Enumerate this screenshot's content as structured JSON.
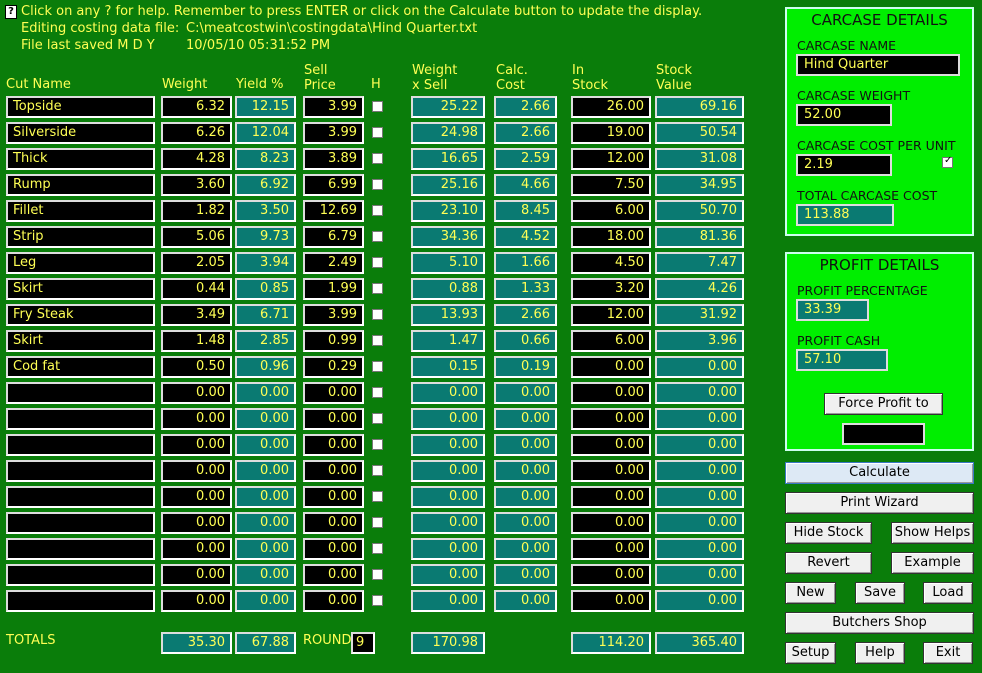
{
  "header": {
    "help_icon": "?",
    "line1": "Click on any ? for help. Remember to press ENTER or click on the Calculate button to update the display.",
    "line2_label": "Editing costing data file:",
    "line2_value": "C:\\meatcostwin\\costingdata\\Hind Quarter.txt",
    "line3_label": "File last saved M D Y",
    "line3_value": "10/05/10 05:31:52 PM"
  },
  "columns": {
    "cut_name": "Cut Name",
    "weight": "Weight",
    "yield": "Yield %",
    "sell_price": "Sell\nPrice",
    "h": "H",
    "weight_x_sell": "Weight\nx Sell",
    "calc_cost": "Calc.\nCost",
    "in_stock": "In\nStock",
    "stock_value": "Stock\nValue"
  },
  "rows": [
    {
      "name": "Topside",
      "weight": "6.32",
      "yield": "12.15",
      "price": "3.99",
      "wxs": "25.22",
      "cost": "2.66",
      "stock": "26.00",
      "value": "69.16"
    },
    {
      "name": "Silverside",
      "weight": "6.26",
      "yield": "12.04",
      "price": "3.99",
      "wxs": "24.98",
      "cost": "2.66",
      "stock": "19.00",
      "value": "50.54"
    },
    {
      "name": "Thick",
      "weight": "4.28",
      "yield": "8.23",
      "price": "3.89",
      "wxs": "16.65",
      "cost": "2.59",
      "stock": "12.00",
      "value": "31.08"
    },
    {
      "name": "Rump",
      "weight": "3.60",
      "yield": "6.92",
      "price": "6.99",
      "wxs": "25.16",
      "cost": "4.66",
      "stock": "7.50",
      "value": "34.95"
    },
    {
      "name": "Fillet",
      "weight": "1.82",
      "yield": "3.50",
      "price": "12.69",
      "wxs": "23.10",
      "cost": "8.45",
      "stock": "6.00",
      "value": "50.70"
    },
    {
      "name": "Strip",
      "weight": "5.06",
      "yield": "9.73",
      "price": "6.79",
      "wxs": "34.36",
      "cost": "4.52",
      "stock": "18.00",
      "value": "81.36"
    },
    {
      "name": "Leg",
      "weight": "2.05",
      "yield": "3.94",
      "price": "2.49",
      "wxs": "5.10",
      "cost": "1.66",
      "stock": "4.50",
      "value": "7.47"
    },
    {
      "name": "Skirt",
      "weight": "0.44",
      "yield": "0.85",
      "price": "1.99",
      "wxs": "0.88",
      "cost": "1.33",
      "stock": "3.20",
      "value": "4.26"
    },
    {
      "name": "Fry Steak",
      "weight": "3.49",
      "yield": "6.71",
      "price": "3.99",
      "wxs": "13.93",
      "cost": "2.66",
      "stock": "12.00",
      "value": "31.92"
    },
    {
      "name": "Skirt",
      "weight": "1.48",
      "yield": "2.85",
      "price": "0.99",
      "wxs": "1.47",
      "cost": "0.66",
      "stock": "6.00",
      "value": "3.96"
    },
    {
      "name": "Cod fat",
      "weight": "0.50",
      "yield": "0.96",
      "price": "0.29",
      "wxs": "0.15",
      "cost": "0.19",
      "stock": "0.00",
      "value": "0.00"
    },
    {
      "name": "",
      "weight": "0.00",
      "yield": "0.00",
      "price": "0.00",
      "wxs": "0.00",
      "cost": "0.00",
      "stock": "0.00",
      "value": "0.00"
    },
    {
      "name": "",
      "weight": "0.00",
      "yield": "0.00",
      "price": "0.00",
      "wxs": "0.00",
      "cost": "0.00",
      "stock": "0.00",
      "value": "0.00"
    },
    {
      "name": "",
      "weight": "0.00",
      "yield": "0.00",
      "price": "0.00",
      "wxs": "0.00",
      "cost": "0.00",
      "stock": "0.00",
      "value": "0.00"
    },
    {
      "name": "",
      "weight": "0.00",
      "yield": "0.00",
      "price": "0.00",
      "wxs": "0.00",
      "cost": "0.00",
      "stock": "0.00",
      "value": "0.00"
    },
    {
      "name": "",
      "weight": "0.00",
      "yield": "0.00",
      "price": "0.00",
      "wxs": "0.00",
      "cost": "0.00",
      "stock": "0.00",
      "value": "0.00"
    },
    {
      "name": "",
      "weight": "0.00",
      "yield": "0.00",
      "price": "0.00",
      "wxs": "0.00",
      "cost": "0.00",
      "stock": "0.00",
      "value": "0.00"
    },
    {
      "name": "",
      "weight": "0.00",
      "yield": "0.00",
      "price": "0.00",
      "wxs": "0.00",
      "cost": "0.00",
      "stock": "0.00",
      "value": "0.00"
    },
    {
      "name": "",
      "weight": "0.00",
      "yield": "0.00",
      "price": "0.00",
      "wxs": "0.00",
      "cost": "0.00",
      "stock": "0.00",
      "value": "0.00"
    },
    {
      "name": "",
      "weight": "0.00",
      "yield": "0.00",
      "price": "0.00",
      "wxs": "0.00",
      "cost": "0.00",
      "stock": "0.00",
      "value": "0.00"
    }
  ],
  "totals": {
    "label": "TOTALS",
    "weight": "35.30",
    "yield": "67.88",
    "round_label": "ROUND",
    "round_value": "9",
    "wxs": "170.98",
    "stock": "114.20",
    "value": "365.40"
  },
  "carcase": {
    "title": "CARCASE DETAILS",
    "name_label": "CARCASE NAME",
    "name_value": "Hind Quarter",
    "weight_label": "CARCASE WEIGHT",
    "weight_value": "52.00",
    "cost_label": "CARCASE COST PER UNIT",
    "cost_value": "2.19",
    "total_label": "TOTAL CARCASE COST",
    "total_value": "113.88"
  },
  "profit": {
    "title": "PROFIT DETAILS",
    "pct_label": "PROFIT PERCENTAGE",
    "pct_value": "33.39",
    "cash_label": "PROFIT CASH",
    "cash_value": "57.10",
    "force_label": "Force Profit to",
    "force_value": ""
  },
  "buttons": {
    "calculate": "Calculate",
    "print_wizard": "Print Wizard",
    "hide_stock": "Hide Stock",
    "show_helps": "Show Helps",
    "revert": "Revert",
    "example": "Example",
    "new": "New",
    "save": "Save",
    "load": "Load",
    "butchers_shop": "Butchers Shop",
    "setup": "Setup",
    "help": "Help",
    "exit": "Exit"
  },
  "colors": {
    "background": "#0a7d0a",
    "text": "#ffff55",
    "cell_black": "#000000",
    "cell_teal": "#0a7a72",
    "panel": "#00ee00"
  }
}
